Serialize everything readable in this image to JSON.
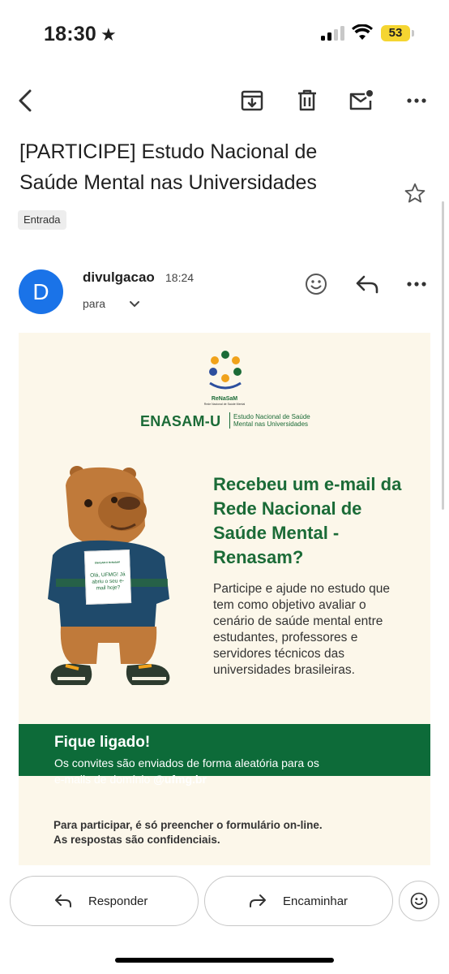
{
  "status_bar": {
    "time": "18:30",
    "battery": "53"
  },
  "subject": "[PARTICIPE] Estudo Nacional de Saúde Mental nas Universidades",
  "label": "Entrada",
  "sender": {
    "initial": "D",
    "name": "divulgacao",
    "time": "18:24",
    "to_label": "para"
  },
  "email_image": {
    "logo_name": "ReNaSaM",
    "logo_tagline": "Rede Nacional de Saúde Mental",
    "brand": "ENASAM-U",
    "brand_sub": "Estudo Nacional de Saúde Mental nas Universidades",
    "card_brand": "ENASAM-U ReNaSaM",
    "card_text": "Olá, UFMG! Já abriu o seu e-mail hoje?",
    "headline": "Recebeu um e-mail da Rede Nacional de Saúde Mental - Renasam?",
    "paragraph": "Participe e ajude no estudo que tem como objetivo avaliar o cenário de saúde mental entre estudantes, professores e servidores técnicos das universidades brasileiras.",
    "band_title": "Fique ligado!",
    "band_text_1": "Os convites são enviados de forma aleatória para os",
    "band_text_2": "e-mails de domínio ",
    "band_text_domain": "@ufmg.br",
    "footer_1": "Para participar, é só preencher o formulário on-line.",
    "footer_2": "As respostas são confidenciais."
  },
  "actions": {
    "reply": "Responder",
    "forward": "Encaminhar"
  },
  "colors": {
    "accent_green": "#1b6b37",
    "avatar_blue": "#1a73e8",
    "band_green": "#0d6b39",
    "battery_yellow": "#f5d531"
  }
}
